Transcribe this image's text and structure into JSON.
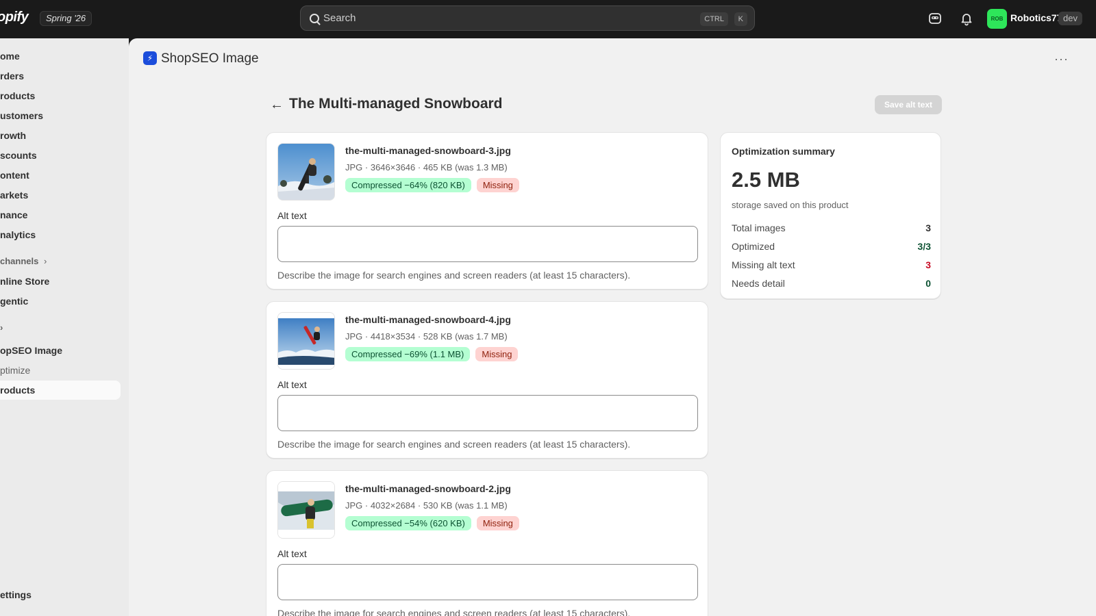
{
  "topbar": {
    "logo": "opify",
    "season": "Spring '26",
    "search_placeholder": "Search",
    "kbd_ctrl": "CTRL",
    "kbd_k": "K",
    "avatar_initials": "ROB",
    "username": "Robotics77",
    "env_badge": "dev"
  },
  "sidebar": {
    "items": [
      "ome",
      "rders",
      "roducts",
      "ustomers",
      "rowth",
      "scounts",
      "ontent",
      "arkets",
      "nance",
      "nalytics"
    ],
    "channels_label": "channels",
    "channels": [
      "nline Store",
      "gentic"
    ],
    "apps_chevron": "›",
    "app_name": "opSEO Image",
    "app_sub": [
      "ptimize",
      "roducts"
    ],
    "settings": "ettings"
  },
  "app": {
    "title": "ShopSEO Image",
    "more": "···"
  },
  "page": {
    "title": "The Multi-managed Snowboard",
    "save_label": "Save alt text",
    "images": [
      {
        "filename": "the-multi-managed-snowboard-3.jpg",
        "meta": "JPG · 3646×3646 · 465 KB (was 1.3 MB)",
        "compressed": "Compressed −64% (820 KB)",
        "status": "Missing",
        "alt_label": "Alt text",
        "alt_value": "",
        "help": "Describe the image for search engines and screen readers (at least 15 characters)."
      },
      {
        "filename": "the-multi-managed-snowboard-4.jpg",
        "meta": "JPG · 4418×3534 · 528 KB (was 1.7 MB)",
        "compressed": "Compressed −69% (1.1 MB)",
        "status": "Missing",
        "alt_label": "Alt text",
        "alt_value": "",
        "help": "Describe the image for search engines and screen readers (at least 15 characters)."
      },
      {
        "filename": "the-multi-managed-snowboard-2.jpg",
        "meta": "JPG · 4032×2684 · 530 KB (was 1.1 MB)",
        "compressed": "Compressed −54% (620 KB)",
        "status": "Missing",
        "alt_label": "Alt text",
        "alt_value": "",
        "help": "Describe the image for search engines and screen readers (at least 15 characters)."
      }
    ]
  },
  "summary": {
    "title": "Optimization summary",
    "saved": "2.5 MB",
    "saved_caption": "storage saved on this product",
    "rows": [
      {
        "label": "Total images",
        "value": "3",
        "color": "#303030"
      },
      {
        "label": "Optimized",
        "value": "3/3",
        "color": "#0c5132"
      },
      {
        "label": "Missing alt text",
        "value": "3",
        "color": "#c70a24"
      },
      {
        "label": "Needs detail",
        "value": "0",
        "color": "#0c5132"
      }
    ]
  },
  "colors": {
    "topbar": "#1a1a1a",
    "success_badge": "#b4fed2",
    "critical_badge": "#fed3d1",
    "app_icon": "#1b4ddb"
  }
}
